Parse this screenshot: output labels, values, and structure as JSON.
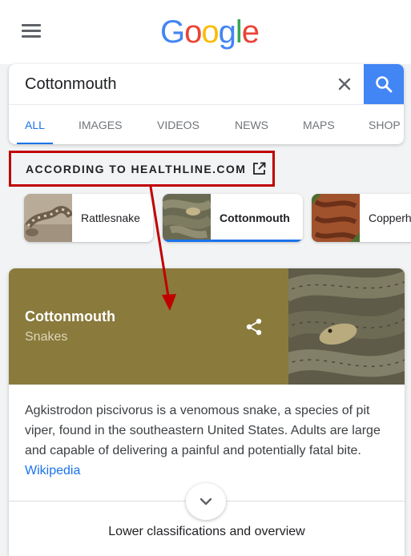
{
  "header": {
    "logo_letters": [
      {
        "char": "G",
        "color": "#4285F4"
      },
      {
        "char": "o",
        "color": "#EA4335"
      },
      {
        "char": "o",
        "color": "#FBBC05"
      },
      {
        "char": "g",
        "color": "#4285F4"
      },
      {
        "char": "l",
        "color": "#34A853"
      },
      {
        "char": "e",
        "color": "#EA4335"
      }
    ],
    "menu_icon": "hamburger-menu-icon"
  },
  "search": {
    "value": "Cottonmouth",
    "clear_icon": "close-icon",
    "submit_icon": "search-icon",
    "button_color": "#4285F4"
  },
  "tabs": [
    {
      "label": "ALL",
      "active": true
    },
    {
      "label": "IMAGES",
      "active": false
    },
    {
      "label": "VIDEOS",
      "active": false
    },
    {
      "label": "NEWS",
      "active": false
    },
    {
      "label": "MAPS",
      "active": false
    },
    {
      "label": "SHOP",
      "active": false
    }
  ],
  "source": {
    "label": "ACCORDING TO HEALTHLINE.COM",
    "icon": "open-in-new-icon",
    "highlight_color": "#C00000"
  },
  "chips": [
    {
      "label": "Rattlesnake",
      "active": false
    },
    {
      "label": "Cottonmouth",
      "active": true
    },
    {
      "label": "Copperhead",
      "active": false
    }
  ],
  "knowledge_panel": {
    "title": "Cottonmouth",
    "subtitle": "Snakes",
    "share_icon": "share-icon",
    "header_color": "#8A7A3C",
    "description": "Agkistrodon piscivorus is a venomous snake, a species of pit viper, found in the southeastern United States. Adults are large and capable of delivering a painful and potentially fatal bite. ",
    "source_link": "Wikipedia",
    "expand_icon": "chevron-down-icon",
    "footer_label": "Lower classifications and overview"
  },
  "annotation": {
    "arrow_color": "#C00000"
  }
}
